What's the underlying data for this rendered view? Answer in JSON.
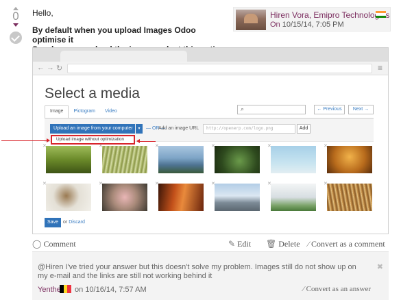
{
  "vote": {
    "count": "0"
  },
  "answer": {
    "greeting": "Hello,",
    "line1": "By default when you upload Images Odoo optimise it",
    "line2": "So when you upload the image, select this option."
  },
  "author": {
    "name": "Hiren Vora, Emipro Technologies",
    "on_label": "On",
    "date": "10/15/14, 7:05 PM"
  },
  "screenshot": {
    "title": "Select a media",
    "tabs": [
      "Image",
      "Pictogram",
      "Video"
    ],
    "prev_label": "← Previous",
    "next_label": "Next →",
    "upload_label": "Upload an image from your computer",
    "or_label": "— OR —",
    "url_label": "Add an image URL",
    "url_placeholder": "http://openerp.com/logo.png",
    "add_label": "Add",
    "dropdown_option": "Upload image without optimization",
    "save_label": "Save",
    "or_discard_or": "or",
    "discard_label": "Discard"
  },
  "actions": {
    "comment": "Comment",
    "edit": "Edit",
    "delete": "Delete",
    "convert": "Convert as a comment"
  },
  "comment": {
    "text": "@Hiren I've tried your answer but this doesn't solve my problem. Images still do not show up on my e-mail and the links are still not working behind it",
    "author": "Yenthe",
    "date_prefix": "on",
    "date": "10/16/14, 7:57 AM",
    "convert": "Convert as an answer"
  },
  "colors": {
    "accent": "#7b2d5f",
    "link": "#3a7dc2",
    "button": "#3073b9",
    "highlight": "#d9242b"
  }
}
